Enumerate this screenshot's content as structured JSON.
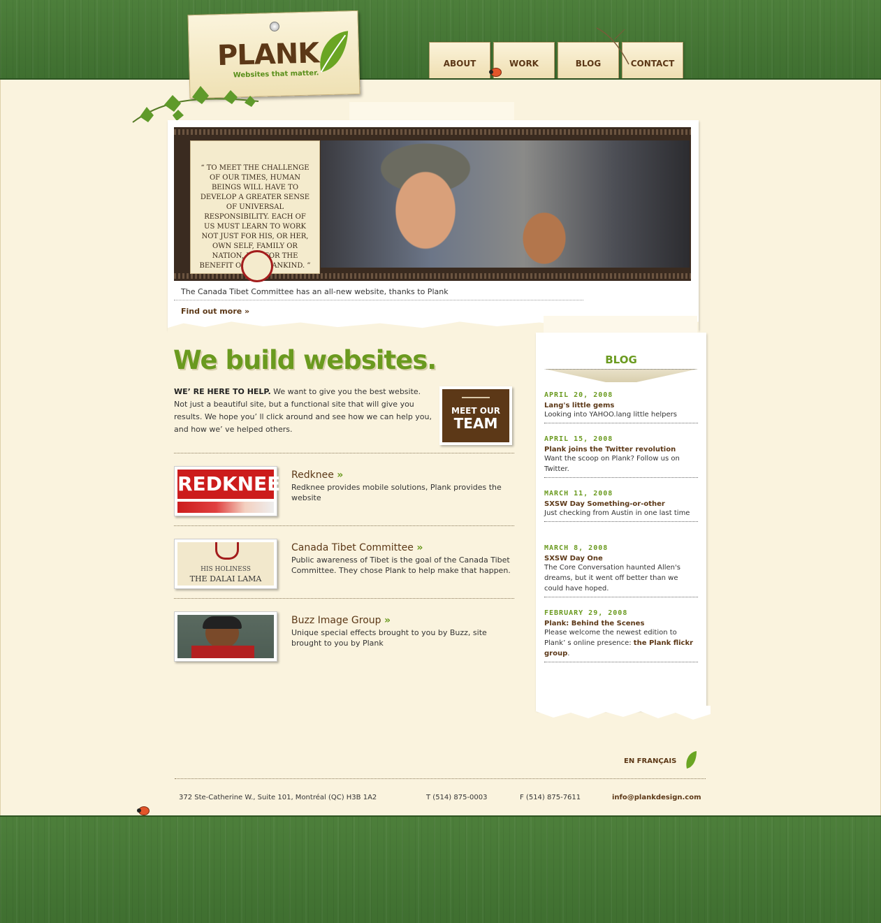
{
  "logo": {
    "name": "PLANK",
    "tagline": "Websites that matter."
  },
  "nav": [
    {
      "label": "ABOUT"
    },
    {
      "label": "WORK"
    },
    {
      "label": "BLOG"
    },
    {
      "label": "CONTACT"
    }
  ],
  "feature": {
    "quote": "“ TO MEET THE CHALLENGE OF OUR TIMES, HUMAN BEINGS WILL HAVE TO DEVELOP A GREATER SENSE OF UNIVERSAL RESPONSIBILITY. EACH OF US MUST LEARN TO WORK NOT JUST FOR HIS, OR HER, OWN SELF, FAMILY OR NATION, BUT FOR THE BENEFIT OF ALL MANKIND. ”",
    "caption": "The Canada Tibet Committee has an all-new website, thanks to Plank",
    "more_label": "Find out more »"
  },
  "main": {
    "headline": "We build websites.",
    "intro_lead": "WE’ RE HERE TO HELP.",
    "intro_text": " We want to give you the best website. Not just a beautiful site, but a functional site that will give you results. We hope you’ ll click around and see how we can help you, and how we’ ve helped others.",
    "team_line1": "MEET OUR",
    "team_line2": "TEAM"
  },
  "projects": [
    {
      "title": "Redknee",
      "thumb_text": "REDKNEE",
      "description": "Redknee provides mobile solutions, Plank provides the website"
    },
    {
      "title": "Canada Tibet Committee",
      "thumb_line1": "HIS HOLINESS",
      "thumb_line2": "THE DALAI LAMA",
      "description": "Public awareness of Tibet is the goal of the Canada Tibet Committee. They chose Plank to help make that happen."
    },
    {
      "title": "Buzz Image Group",
      "description": "Unique special effects brought to you by Buzz, site brought to you by Plank"
    }
  ],
  "blog": {
    "heading": "BLOG",
    "posts": [
      {
        "date": "APRIL 20, 2008",
        "title": "Lang's little gems",
        "text": "Looking into YAHOO.lang little helpers"
      },
      {
        "date": "APRIL 15, 2008",
        "title": "Plank joins the Twitter revolution",
        "text": "Want the scoop on Plank? Follow us on Twitter."
      },
      {
        "date": "MARCH 11, 2008",
        "title": "SXSW Day Something-or-other",
        "text": "Just checking from Austin in one last time"
      },
      {
        "date": "MARCH 8, 2008",
        "title": "SXSW Day One",
        "text": "The Core Conversation haunted Allen's dreams, but it went off better than we could have hoped."
      },
      {
        "date": "FEBRUARY 29, 2008",
        "title": "Plank: Behind the Scenes",
        "text": "Please welcome the newest edition to Plank’ s online presence: ",
        "link": "the Plank flickr group",
        "text_end": "."
      }
    ]
  },
  "footer": {
    "lang": "EN FRANÇAIS",
    "address": "372 Ste-Catherine W., Suite 101, Montréal (QC) H3B 1A2",
    "phone": "T (514) 875-0003",
    "fax": "F (514) 875-7611",
    "email": "info@plankdesign.com"
  },
  "colors": {
    "wood_green": "#4d7f3b",
    "brown": "#5c3817",
    "accent_green": "#6a9a1f",
    "cream": "#faf3de"
  }
}
